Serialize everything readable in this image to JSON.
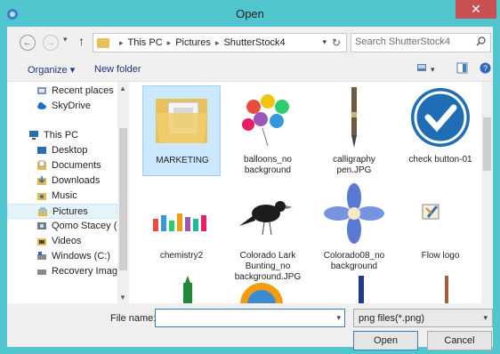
{
  "window": {
    "title": "Open",
    "close_glyph": "✕"
  },
  "address_bar": {
    "crumbs": [
      "This PC",
      "Pictures",
      "ShutterStock4"
    ]
  },
  "search": {
    "placeholder": "Search ShutterStock4"
  },
  "toolbar": {
    "organize_label": "Organize ▾",
    "new_folder_label": "New folder"
  },
  "nav_pane": {
    "items": [
      {
        "label": "Recent places",
        "icon": "recent-places-icon"
      },
      {
        "label": "SkyDrive",
        "icon": "skydrive-icon"
      },
      {
        "label": "This PC",
        "icon": "this-pc-icon"
      },
      {
        "label": "Desktop",
        "icon": "desktop-icon"
      },
      {
        "label": "Documents",
        "icon": "documents-icon"
      },
      {
        "label": "Downloads",
        "icon": "downloads-icon"
      },
      {
        "label": "Music",
        "icon": "music-icon"
      },
      {
        "label": "Pictures",
        "icon": "pictures-icon",
        "selected": true
      },
      {
        "label": "Qomo Stacey (qo",
        "icon": "user-icon"
      },
      {
        "label": "Videos",
        "icon": "videos-icon"
      },
      {
        "label": "Windows (C:)",
        "icon": "drive-icon"
      },
      {
        "label": "Recovery Image (",
        "icon": "drive-icon"
      }
    ]
  },
  "files": [
    {
      "name": "MARKETING",
      "kind": "folder",
      "selected": true
    },
    {
      "name": "balloons_no background",
      "kind": "image"
    },
    {
      "name": "calligraphy pen.JPG",
      "kind": "image"
    },
    {
      "name": "check button-01",
      "kind": "image"
    },
    {
      "name": "chemistry2",
      "kind": "image"
    },
    {
      "name": "Colorado Lark Bunting_no background.JPG",
      "kind": "image"
    },
    {
      "name": "Colorado08_no background",
      "kind": "image"
    },
    {
      "name": "Flow logo",
      "kind": "image"
    }
  ],
  "footer": {
    "file_name_label": "File name:",
    "file_name_value": "",
    "file_type_value": "png files(*.png)",
    "open_label": "Open",
    "cancel_label": "Cancel"
  },
  "colors": {
    "frame": "#52c6cf",
    "close": "#c75050",
    "selection": "#cce8ff",
    "link": "#1e3287"
  }
}
